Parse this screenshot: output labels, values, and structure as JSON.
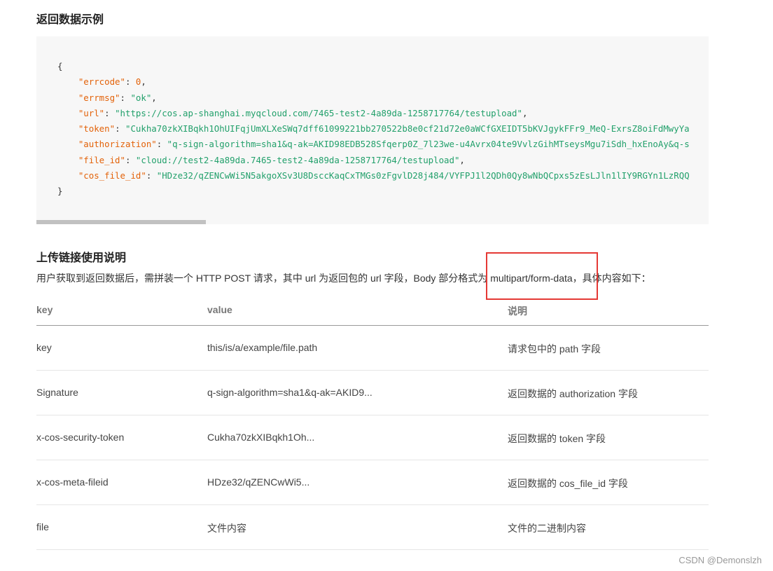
{
  "sections": {
    "response_example_title": "返回数据示例",
    "upload_usage_title": "上传链接使用说明"
  },
  "code": {
    "open": "{",
    "close": "}",
    "lines": [
      {
        "key": "\"errcode\"",
        "value": "0",
        "type": "number",
        "comma": ","
      },
      {
        "key": "\"errmsg\"",
        "value": "\"ok\"",
        "type": "string",
        "comma": ","
      },
      {
        "key": "\"url\"",
        "value": "\"https://cos.ap-shanghai.myqcloud.com/7465-test2-4a89da-1258717764/testupload\"",
        "type": "string",
        "comma": ","
      },
      {
        "key": "\"token\"",
        "value": "\"Cukha70zkXIBqkh1OhUIFqjUmXLXeSWq7dff61099221bb270522b8e0cf21d72e0aWCfGXEIDT5bKVJgykFFr9_MeQ-ExrsZ8oiFdMwyYa",
        "type": "string",
        "comma": ""
      },
      {
        "key": "\"authorization\"",
        "value": "\"q-sign-algorithm=sha1&q-ak=AKID98EDB528Sfqerp0Z_7l23we-u4Avrx04te9VvlzGihMTseysMgu7iSdh_hxEnoAy&q-s",
        "type": "string",
        "comma": ""
      },
      {
        "key": "\"file_id\"",
        "value": "\"cloud://test2-4a89da.7465-test2-4a89da-1258717764/testupload\"",
        "type": "string",
        "comma": ","
      },
      {
        "key": "\"cos_file_id\"",
        "value": "\"HDze32/qZENCwWi5N5akgoXSv3U8DsccKaqCxTMGs0zFgvlD28j484/VYFPJ1l2QDh0Qy8wNbQCpxs5zEsLJln1lIY9RGYn1LzRQQ",
        "type": "string",
        "comma": ""
      }
    ]
  },
  "intro": "用户获取到返回数据后，需拼装一个 HTTP POST 请求，其中 url 为返回包的 url 字段，Body 部分格式为 multipart/form-data，具体内容如下：",
  "table": {
    "headers": [
      "key",
      "value",
      "说明"
    ],
    "rows": [
      [
        "key",
        "this/is/a/example/file.path",
        "请求包中的 path 字段"
      ],
      [
        "Signature",
        "q-sign-algorithm=sha1&q-ak=AKID9...",
        "返回数据的 authorization 字段"
      ],
      [
        "x-cos-security-token",
        "Cukha70zkXIBqkh1Oh...",
        "返回数据的 token 字段"
      ],
      [
        "x-cos-meta-fileid",
        "HDze32/qZENCwWi5...",
        "返回数据的 cos_file_id 字段"
      ],
      [
        "file",
        "文件内容",
        "文件的二进制内容"
      ]
    ]
  },
  "watermark": "CSDN @Demonslzh",
  "colors": {
    "json_key": "#e36209",
    "json_string": "#22a06b",
    "highlight_box": "#e53935"
  }
}
